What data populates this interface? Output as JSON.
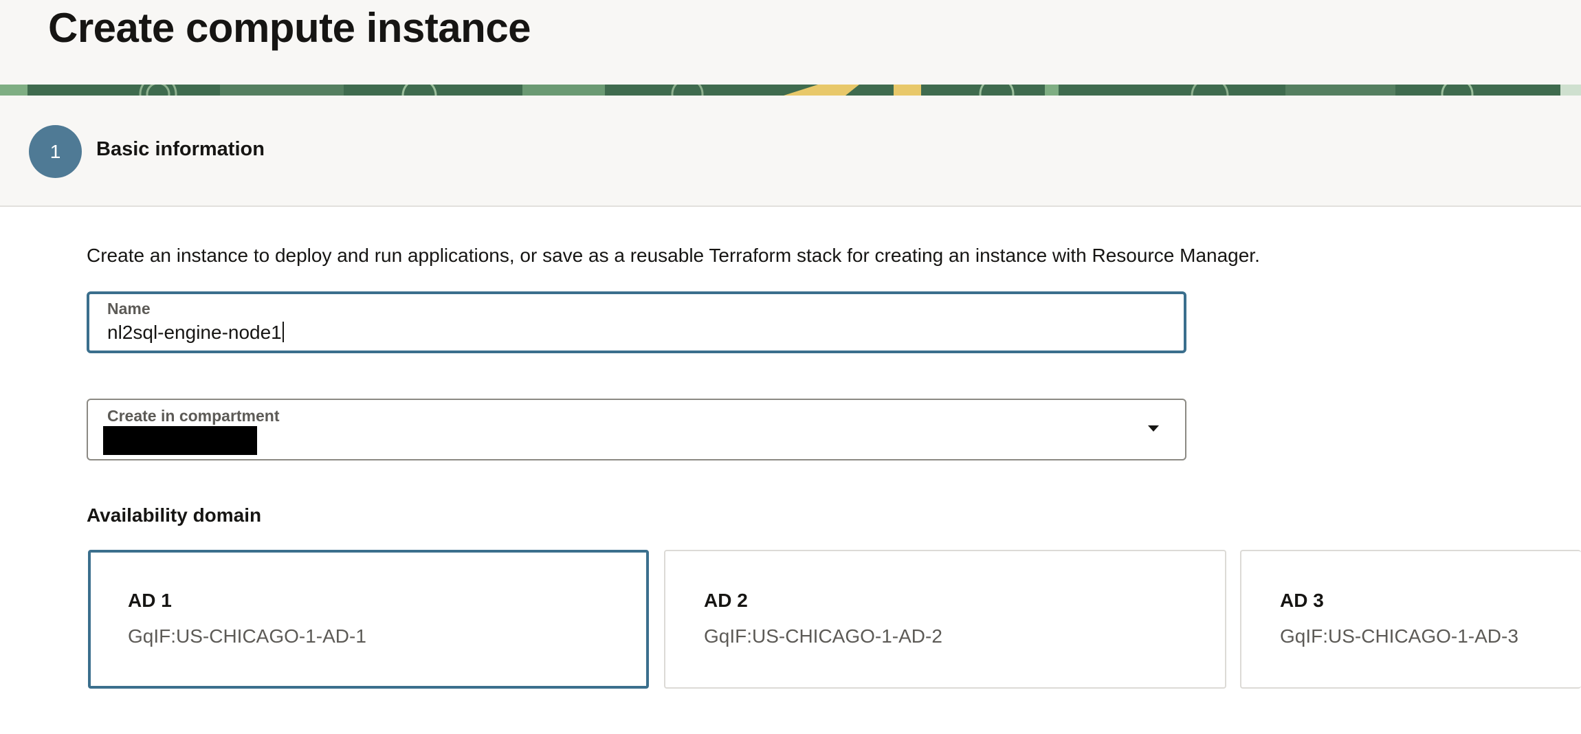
{
  "header": {
    "title": "Create compute instance"
  },
  "steps": [
    {
      "number": "1",
      "label": "Basic information"
    }
  ],
  "intro": "Create an instance to deploy and run applications, or save as a reusable Terraform stack for creating an instance with Resource Manager.",
  "name_field": {
    "label": "Name",
    "value": "nl2sql-engine-node1"
  },
  "compartment_field": {
    "label": "Create in compartment",
    "value_redacted": true
  },
  "availability_domain": {
    "label": "Availability domain",
    "selected": "AD 1",
    "options": [
      {
        "title": "AD 1",
        "subtitle": "GqIF:US-CHICAGO-1-AD-1"
      },
      {
        "title": "AD 2",
        "subtitle": "GqIF:US-CHICAGO-1-AD-2"
      },
      {
        "title": "AD 3",
        "subtitle": "GqIF:US-CHICAGO-1-AD-3"
      }
    ]
  },
  "icons": {
    "dropdown": "chevron-down-icon"
  },
  "colors": {
    "accent": "#3b6f8d",
    "step_circle": "#4f7a95",
    "header_bg": "#f8f7f5"
  }
}
